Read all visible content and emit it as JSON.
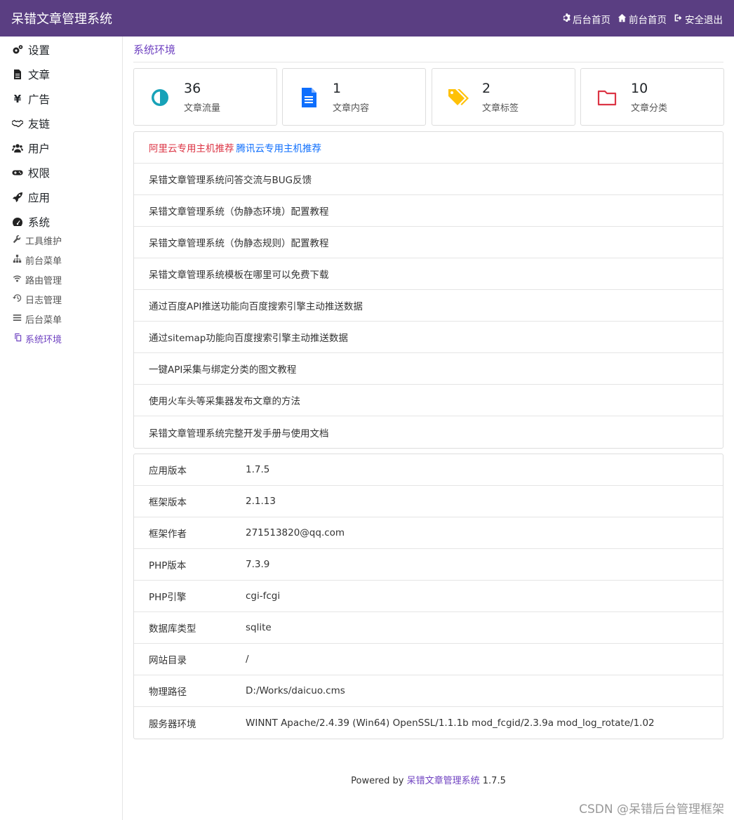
{
  "header": {
    "brand": "呆错文章管理系统",
    "nav": [
      {
        "label": "后台首页",
        "icon": "gear-icon"
      },
      {
        "label": "前台首页",
        "icon": "home-icon"
      },
      {
        "label": "安全退出",
        "icon": "sign-out-icon"
      }
    ]
  },
  "sidebar": {
    "items": [
      {
        "label": "设置",
        "icon": "cogs-icon"
      },
      {
        "label": "文章",
        "icon": "file-icon"
      },
      {
        "label": "广告",
        "icon": "yen-icon"
      },
      {
        "label": "友链",
        "icon": "handshake-icon"
      },
      {
        "label": "用户",
        "icon": "users-icon"
      },
      {
        "label": "权限",
        "icon": "gamepad-icon"
      },
      {
        "label": "应用",
        "icon": "rocket-icon"
      },
      {
        "label": "系统",
        "icon": "dashboard-icon"
      }
    ],
    "subitems": [
      {
        "label": "工具维护",
        "icon": "wrench-icon"
      },
      {
        "label": "前台菜单",
        "icon": "sitemap-icon"
      },
      {
        "label": "路由管理",
        "icon": "wifi-icon"
      },
      {
        "label": "日志管理",
        "icon": "history-icon"
      },
      {
        "label": "后台菜单",
        "icon": "bars-icon"
      },
      {
        "label": "系统环境",
        "icon": "copy-icon",
        "active": true
      }
    ]
  },
  "main": {
    "title": "系统环境",
    "stats": [
      {
        "value": "36",
        "label": "文章流量",
        "icon": "adjust-icon",
        "color": "#17a2b8"
      },
      {
        "value": "1",
        "label": "文章内容",
        "icon": "file-text-icon",
        "color": "#0d6efd"
      },
      {
        "value": "2",
        "label": "文章标签",
        "icon": "tags-icon",
        "color": "#ffc107"
      },
      {
        "value": "10",
        "label": "文章分类",
        "icon": "folder-icon",
        "color": "#dc3545"
      }
    ],
    "promo": {
      "aliyun": "阿里云专用主机推荐",
      "tencent": "腾讯云专用主机推荐"
    },
    "links": [
      "呆错文章管理系统问答交流与BUG反馈",
      "呆错文章管理系统（伪静态环境）配置教程",
      "呆错文章管理系统（伪静态规则）配置教程",
      "呆错文章管理系统模板在哪里可以免费下载",
      "通过百度API推送功能向百度搜索引擎主动推送数据",
      "通过sitemap功能向百度搜索引擎主动推送数据",
      "一键API采集与绑定分类的图文教程",
      "使用火车头等采集器发布文章的方法",
      "呆错文章管理系统完整开发手册与使用文档"
    ],
    "info": [
      {
        "key": "应用版本",
        "value": "1.7.5"
      },
      {
        "key": "框架版本",
        "value": "2.1.13"
      },
      {
        "key": "框架作者",
        "value": "271513820@qq.com"
      },
      {
        "key": "PHP版本",
        "value": "7.3.9"
      },
      {
        "key": "PHP引擎",
        "value": "cgi-fcgi"
      },
      {
        "key": "数据库类型",
        "value": "sqlite"
      },
      {
        "key": "网站目录",
        "value": "/"
      },
      {
        "key": "物理路径",
        "value": "D:/Works/daicuo.cms"
      },
      {
        "key": "服务器环境",
        "value": "WINNT Apache/2.4.39 (Win64) OpenSSL/1.1.1b mod_fcgid/2.3.9a mod_log_rotate/1.02"
      }
    ]
  },
  "footer": {
    "prefix": "Powered by",
    "link": "呆错文章管理系统",
    "version": "1.7.5"
  },
  "watermark": "CSDN @呆错后台管理框架"
}
